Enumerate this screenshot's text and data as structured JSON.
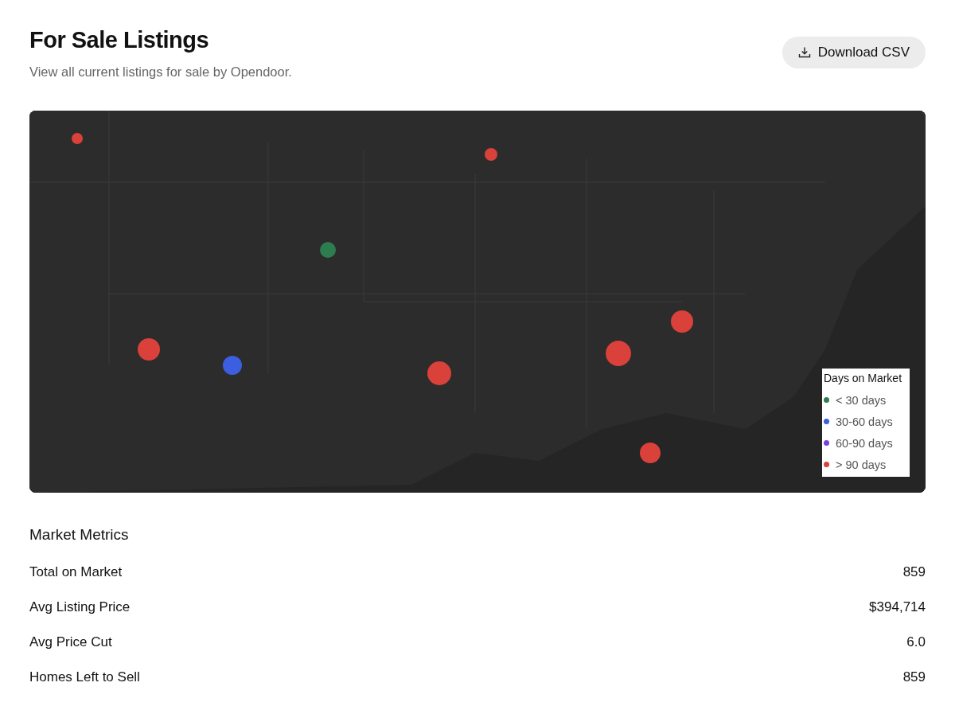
{
  "header": {
    "title": "For Sale Listings",
    "subtitle": "View all current listings for sale by Opendoor.",
    "download_button": "Download CSV"
  },
  "map": {
    "kind": "picture",
    "legend": {
      "title": "Days on Market",
      "items": [
        {
          "label": "< 30 days",
          "color": "#2e7d4f"
        },
        {
          "label": "30-60 days",
          "color": "#3b5fe0"
        },
        {
          "label": "60-90 days",
          "color": "#7b3fe4"
        },
        {
          "label": "> 90 days",
          "color": "#d9413a"
        }
      ]
    }
  },
  "metrics": {
    "title": "Market Metrics",
    "rows": [
      {
        "label": "Total on Market",
        "value": "859"
      },
      {
        "label": "Avg Listing Price",
        "value": "$394,714"
      },
      {
        "label": "Avg Price Cut",
        "value": "6.0"
      },
      {
        "label": "Homes Left to Sell",
        "value": "859"
      }
    ]
  }
}
